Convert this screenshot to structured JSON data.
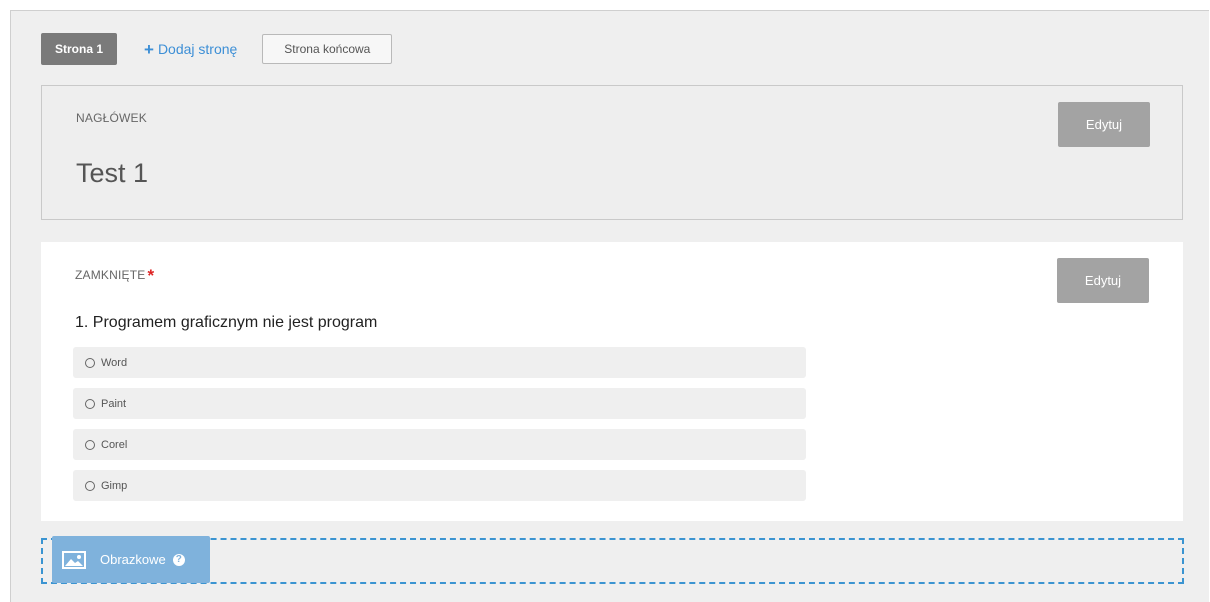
{
  "tabs": {
    "page1": "Strona 1",
    "add_page": "Dodaj stronę",
    "add_icon": "+",
    "end_page": "Strona końcowa"
  },
  "header_section": {
    "label": "NAGŁÓWEK",
    "title": "Test 1",
    "edit": "Edytuj"
  },
  "question_section": {
    "label": "ZAMKNIĘTE",
    "required_mark": "*",
    "edit": "Edytuj",
    "question": "1. Programem graficznym nie jest program",
    "options": [
      "Word",
      "Paint",
      "Corel",
      "Gimp"
    ]
  },
  "drop_zone": {
    "chip_label": "Obrazkowe",
    "help_icon": "?",
    "icon": "image-icon"
  },
  "colors": {
    "accent": "#3b94d1",
    "chip": "#7fb2dc",
    "active_tab": "#7a7a7a",
    "edit_button": "#a3a3a3",
    "required": "#dd2222"
  }
}
